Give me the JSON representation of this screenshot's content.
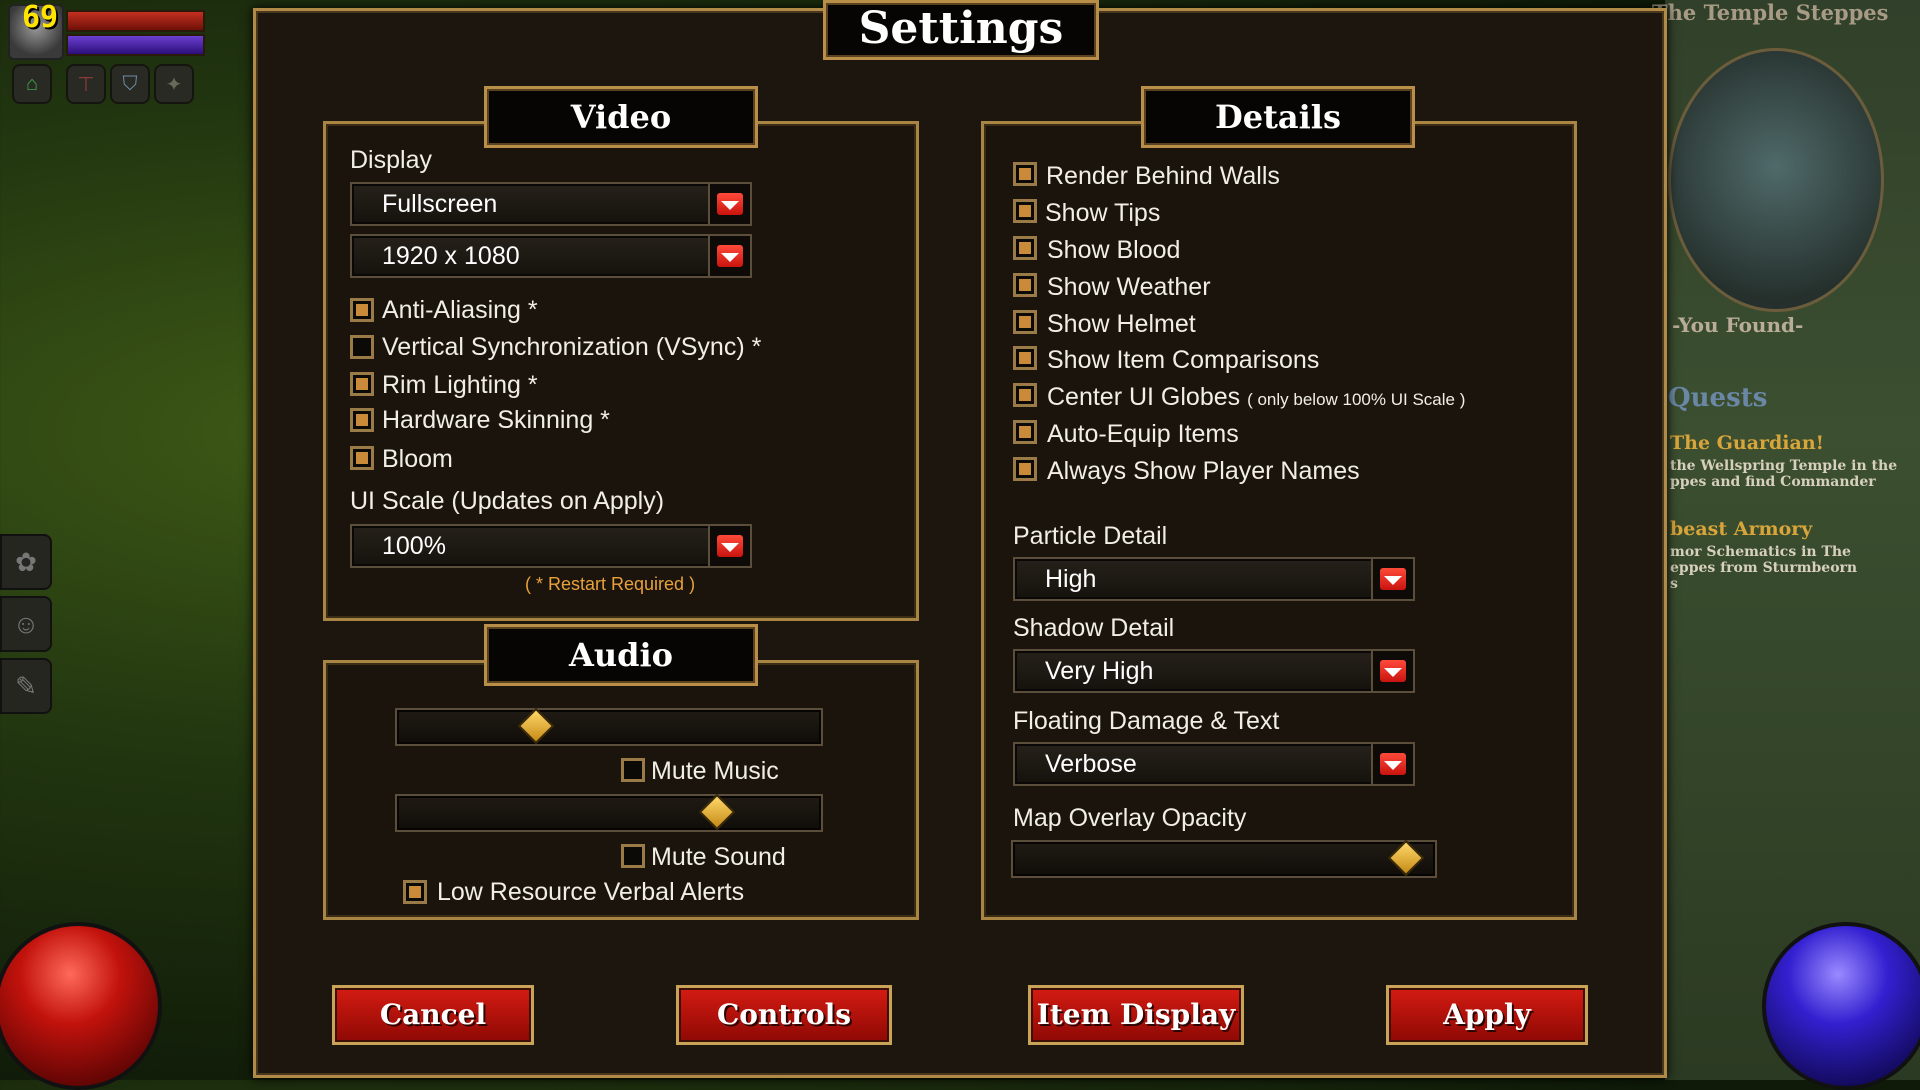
{
  "hud": {
    "fps": "69",
    "zone_name": "The Temple Steppes",
    "you_found": "-You Found-",
    "quests_title": "Quests",
    "quests": [
      {
        "title": "The Guardian!",
        "lines": [
          "the Wellspring Temple in the",
          "ppes and find Commander"
        ]
      },
      {
        "title": "beast Armory",
        "lines": [
          "mor Schematics in The",
          "eppes from Sturmbeorn",
          "s"
        ]
      }
    ]
  },
  "settings": {
    "title": "Settings",
    "video": {
      "title": "Video",
      "display_label": "Display",
      "display_mode": "Fullscreen",
      "resolution": "1920 x 1080",
      "checkboxes": [
        {
          "label": "Anti-Aliasing *",
          "checked": true
        },
        {
          "label": "Vertical Synchronization (VSync) *",
          "checked": false
        },
        {
          "label": "Rim Lighting *",
          "checked": true
        },
        {
          "label": "Hardware Skinning *",
          "checked": true
        },
        {
          "label": "Bloom",
          "checked": true
        }
      ],
      "ui_scale_label": "UI Scale (Updates on Apply)",
      "ui_scale": "100%",
      "restart_note": "( * Restart Required )"
    },
    "audio": {
      "title": "Audio",
      "music_volume": 0.31,
      "sound_volume": 0.77,
      "mute_music": {
        "label": "Mute Music",
        "checked": false
      },
      "mute_sound": {
        "label": "Mute Sound",
        "checked": false
      },
      "low_resource_alerts": {
        "label": "Low Resource Verbal Alerts",
        "checked": true
      }
    },
    "details": {
      "title": "Details",
      "checkboxes": [
        {
          "label": "Render Behind Walls",
          "checked": true
        },
        {
          "label": "Show Tips",
          "checked": true
        },
        {
          "label": "Show Blood",
          "checked": true
        },
        {
          "label": "Show Weather",
          "checked": true
        },
        {
          "label": "Show Helmet",
          "checked": true
        },
        {
          "label": "Show Item Comparisons",
          "checked": true
        },
        {
          "label": "Center UI Globes",
          "note": "( only below 100% UI Scale )",
          "checked": true
        },
        {
          "label": "Auto-Equip Items",
          "checked": true
        },
        {
          "label": "Always Show Player Names",
          "checked": true
        }
      ],
      "particle_label": "Particle Detail",
      "particle_value": "High",
      "shadow_label": "Shadow Detail",
      "shadow_value": "Very High",
      "floating_label": "Floating Damage & Text",
      "floating_value": "Verbose",
      "map_overlay_label": "Map Overlay Opacity",
      "map_overlay_value": 0.96
    },
    "buttons": {
      "cancel": "Cancel",
      "controls": "Controls",
      "item_display": "Item Display",
      "apply": "Apply"
    }
  },
  "colors": {
    "accent_gold": "#b18a48",
    "button_red": "#d41c12",
    "hint_orange": "#e9a13a"
  }
}
